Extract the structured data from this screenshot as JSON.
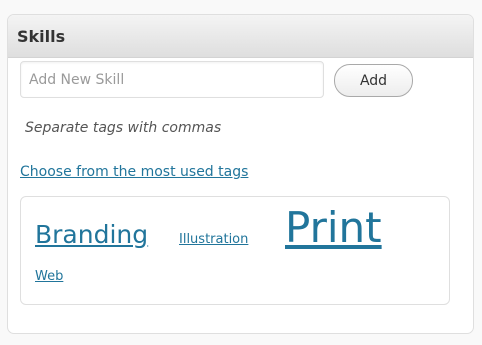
{
  "panel": {
    "title": "Skills"
  },
  "input": {
    "placeholder": "Add New Skill",
    "value": ""
  },
  "add_button_label": "Add",
  "hint": "Separate tags with commas",
  "most_used_link": "Choose from the most used tags",
  "tags": [
    {
      "label": "Branding"
    },
    {
      "label": "Illustration"
    },
    {
      "label": "Print"
    },
    {
      "label": "Web"
    }
  ],
  "colors": {
    "link": "#21759b",
    "header_top": "#f4f4f4",
    "header_bottom": "#dedede",
    "border": "#dfdfdf"
  }
}
